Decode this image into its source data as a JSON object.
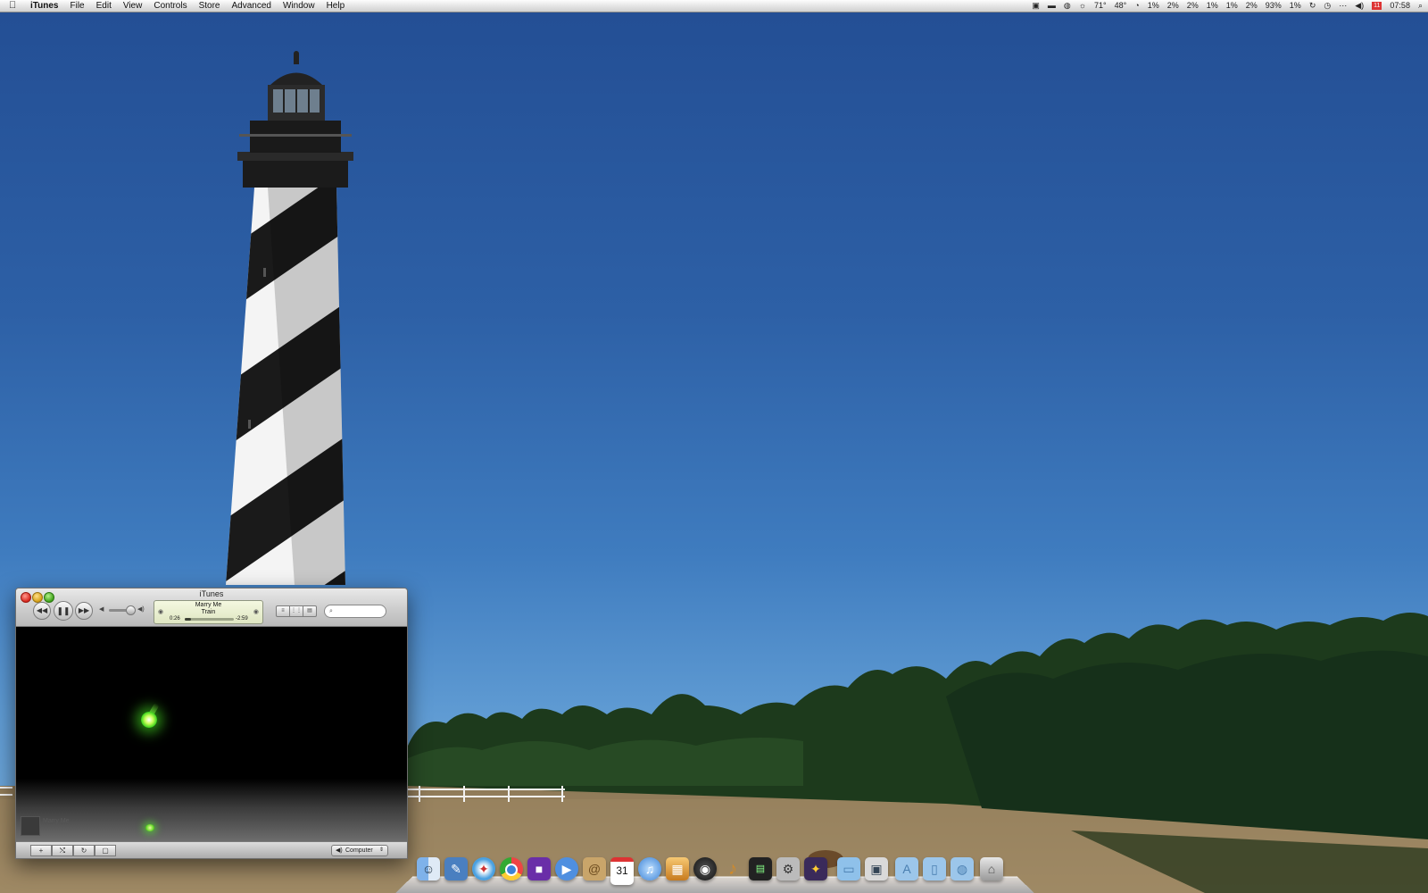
{
  "menubar": {
    "app_name": "iTunes",
    "menus": [
      "File",
      "Edit",
      "View",
      "Controls",
      "Store",
      "Advanced",
      "Window",
      "Help"
    ],
    "status": {
      "temperature": "71°",
      "temp2": "48°",
      "cpu": [
        "1%",
        "2%",
        "2%",
        "1%",
        "1%",
        "2%",
        "93%",
        "1%"
      ],
      "clock": "07:58",
      "calendar_day": "11"
    }
  },
  "itunes": {
    "window_title": "iTunes",
    "now_playing": {
      "title": "Marry Me",
      "artist": "Train",
      "elapsed": "0:26",
      "remaining": "-2:59",
      "progress": 0.13
    },
    "volume": 0.85,
    "mini_track_label": "Marry Me",
    "speaker_output": "Computer"
  },
  "dock": {
    "calendar_date": "31",
    "icons": [
      "finder-icon",
      "preview-icon",
      "safari-icon",
      "chrome-icon",
      "app-icon",
      "ichat-icon",
      "address-book-icon",
      "ical-icon",
      "itunes-icon",
      "iphoto-icon",
      "aperture-icon",
      "garageband-icon",
      "activity-monitor-icon",
      "utility-icon",
      "app2-icon",
      "folder-icon",
      "preview2-icon",
      "downloads-icon",
      "documents-icon",
      "folder3-icon",
      "trash-icon"
    ]
  }
}
